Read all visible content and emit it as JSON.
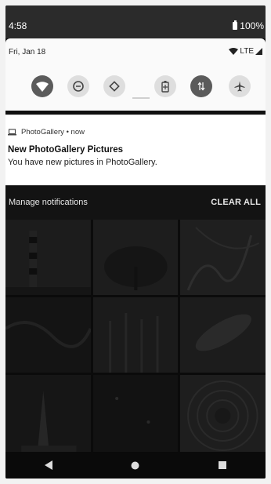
{
  "status_bar": {
    "time": "4:58",
    "battery": "100%"
  },
  "quick_settings": {
    "date": "Fri, Jan 18",
    "network": "LTE",
    "tiles": [
      {
        "name": "wifi",
        "icon": "wifi-icon",
        "state": "on"
      },
      {
        "name": "do-not-disturb",
        "icon": "do-not-disturb-icon",
        "state": "off"
      },
      {
        "name": "auto-rotate",
        "icon": "auto-rotate-icon",
        "state": "off"
      },
      {
        "name": "battery-saver",
        "icon": "battery-saver-icon",
        "state": "off"
      },
      {
        "name": "mobile-data",
        "icon": "mobile-data-icon",
        "state": "on"
      },
      {
        "name": "airplane-mode",
        "icon": "airplane-icon",
        "state": "off"
      }
    ]
  },
  "notification": {
    "app_name": "PhotoGallery",
    "time": "now",
    "title": "New PhotoGallery Pictures",
    "text": "You have new pictures in PhotoGallery."
  },
  "manage_bar": {
    "manage": "Manage notifications",
    "clear_all": "CLEAR ALL"
  },
  "nav": {
    "back": "back-icon",
    "home": "home-icon",
    "recents": "recents-icon"
  },
  "colors": {
    "tile_on": "#5b5b5b",
    "tile_off": "#dedede",
    "panel_bg": "#fafafa",
    "status_bg": "#2b2b2b"
  }
}
